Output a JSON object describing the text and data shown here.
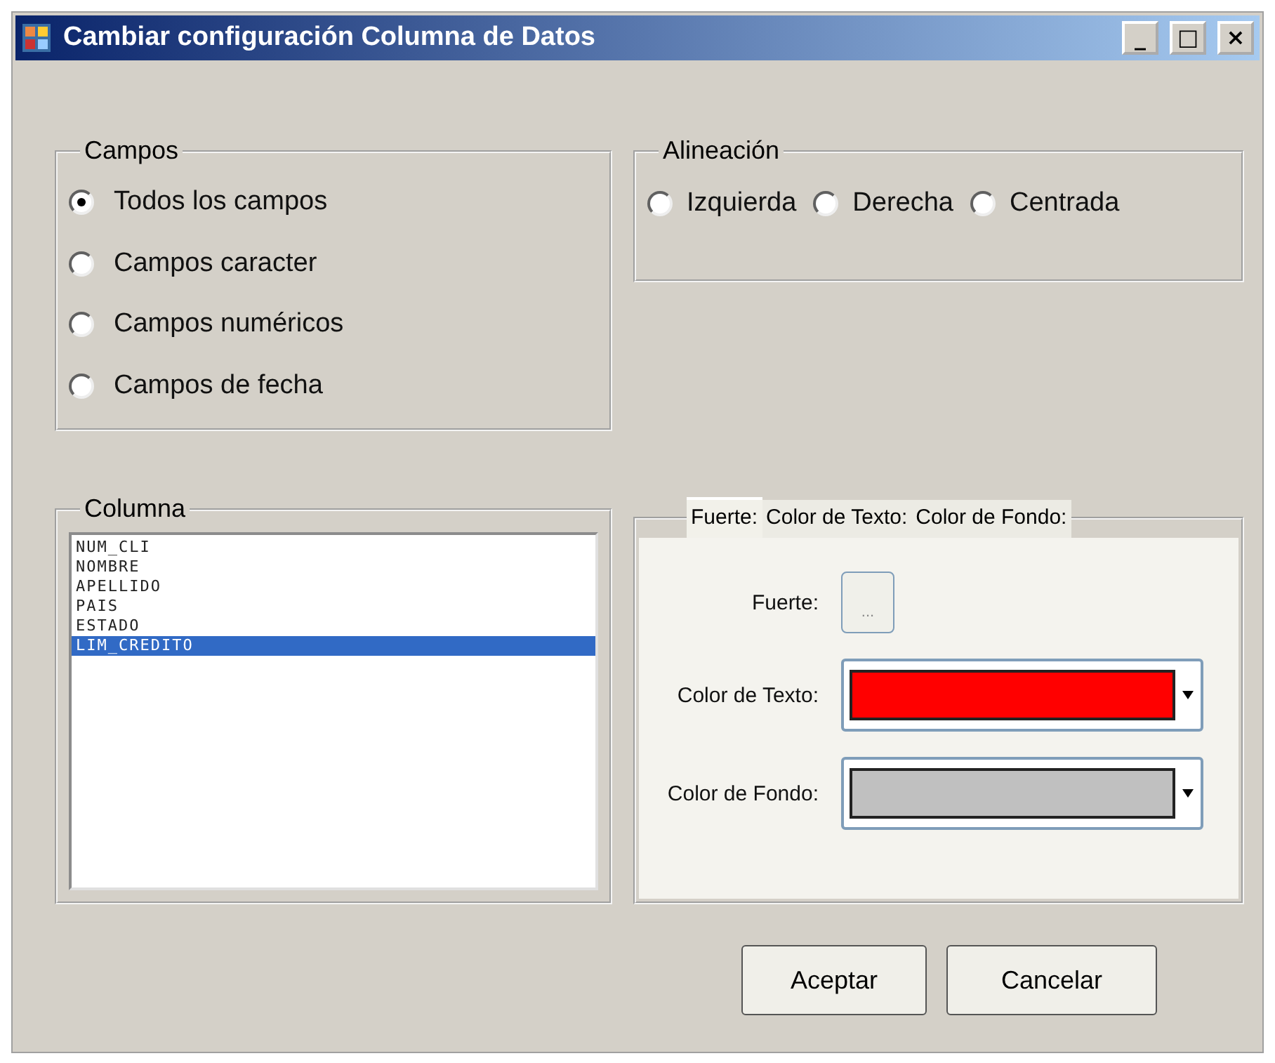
{
  "window": {
    "title": "Cambiar configuración Columna de Datos",
    "controls": [
      "_",
      "□",
      "×"
    ]
  },
  "campos": {
    "title": "Campos",
    "options": [
      {
        "label": "Todos los campos",
        "selected": true
      },
      {
        "label": "Campos caracter",
        "selected": false
      },
      {
        "label": "Campos numéricos",
        "selected": false
      },
      {
        "label": "Campos de fecha",
        "selected": false
      }
    ]
  },
  "alineacion": {
    "title": "Alineación",
    "options": [
      {
        "label": "Izquierda",
        "selected": false
      },
      {
        "label": "Derecha",
        "selected": false
      },
      {
        "label": "Centrada",
        "selected": false
      }
    ]
  },
  "columna": {
    "title": "Columna",
    "items": [
      {
        "label": "NUM_CLI",
        "selected": false
      },
      {
        "label": "NOMBRE",
        "selected": false
      },
      {
        "label": "APELLIDO",
        "selected": false
      },
      {
        "label": "PAIS",
        "selected": false
      },
      {
        "label": "ESTADO",
        "selected": false
      },
      {
        "label": "LIM_CREDITO",
        "selected": true
      }
    ]
  },
  "tabs": [
    {
      "label": "Fuerte:",
      "selected": true
    },
    {
      "label": "Color de Texto:",
      "selected": false
    },
    {
      "label": "Color de Fondo:",
      "selected": false
    }
  ],
  "fields": [
    {
      "kind": "button",
      "label": "Fuerte:",
      "value": "..."
    },
    {
      "kind": "color",
      "label": "Color de Texto:",
      "color": "#ff0000"
    },
    {
      "kind": "color",
      "label": "Color de Fondo:",
      "color": "#c0c0c0"
    }
  ],
  "buttons": [
    "Aceptar",
    "Cancelar"
  ]
}
